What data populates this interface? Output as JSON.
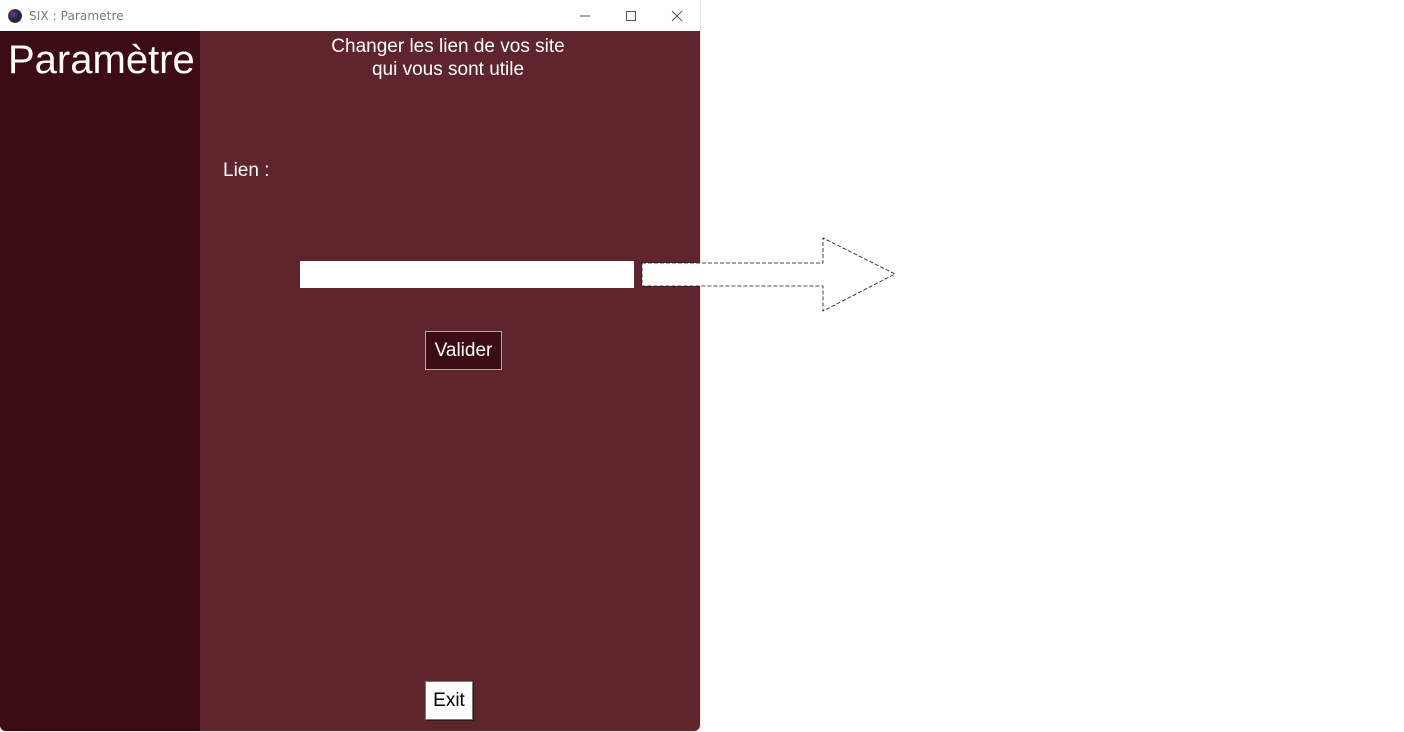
{
  "window": {
    "title": "SIX : Parametre",
    "controls": {
      "minimize": "minimize-icon",
      "maximize": "maximize-icon",
      "close": "close-icon"
    }
  },
  "sidebar": {
    "title": "Paramètre"
  },
  "main": {
    "heading_line1": "Changer les lien de vos site",
    "heading_line2": "qui vous sont utile",
    "link_label": "Lien :",
    "link_value": "",
    "validate_label": "Valider",
    "exit_label": "Exit"
  },
  "colors": {
    "sidebar_bg": "#3b0c11",
    "main_bg": "#5e252d",
    "text": "#ffffff"
  },
  "overlay": {
    "arrow_icon": "arrow-right-icon"
  }
}
